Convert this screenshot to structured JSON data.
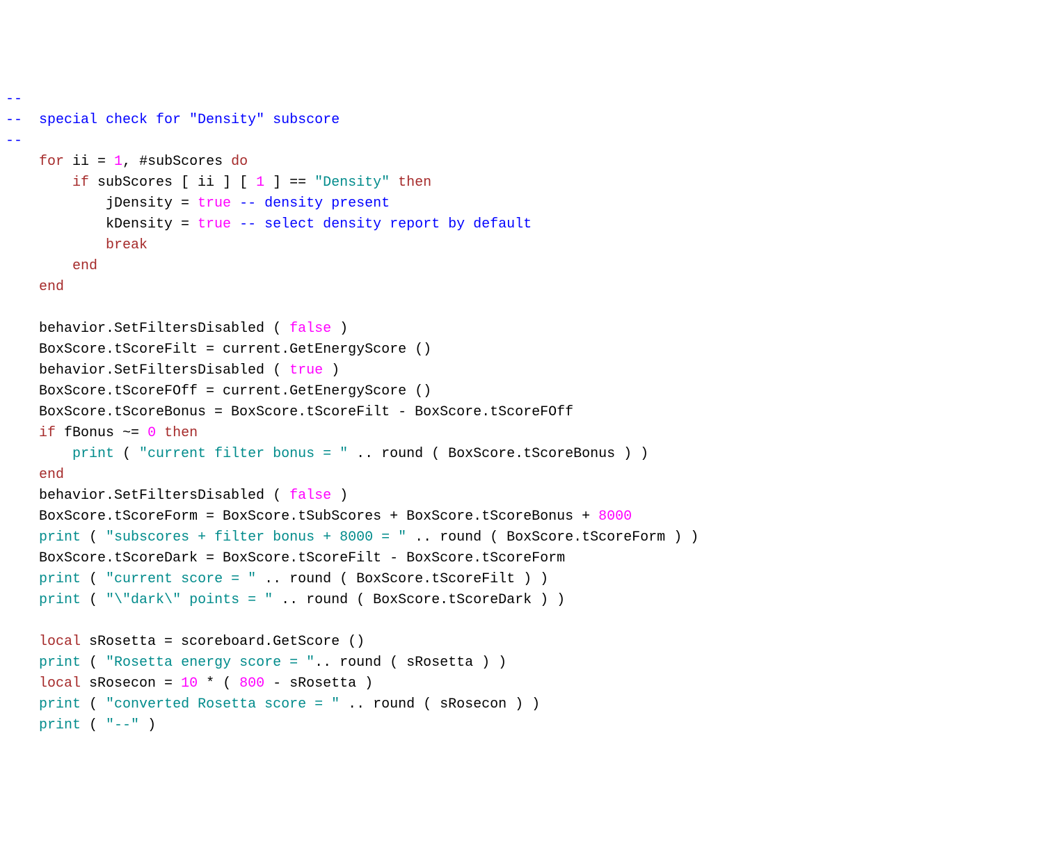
{
  "code": {
    "l01": "--",
    "l02a": "--  ",
    "l02b": "special check for \"Density\" subscore",
    "l03": "--",
    "l04_for": "for",
    "l04_ii": " ii = ",
    "l04_one": "1",
    "l04_rest": ", #subScores ",
    "l04_do": "do",
    "l05_if": "if",
    "l05_cond": " subScores [ ii ] [ ",
    "l05_one": "1",
    "l05_close": " ] == ",
    "l05_str": "\"Density\"",
    "l05_then": " then",
    "l06_a": "            jDensity = ",
    "l06_true": "true",
    "l06_c": " -- density present",
    "l07_a": "            kDensity = ",
    "l07_true": "true",
    "l07_c": " -- select density report by default",
    "l08_break": "break",
    "l09_end": "end",
    "l10_end": "end",
    "l12": "    behavior.SetFiltersDisabled ( ",
    "l12_false": "false",
    "l12_b": " )",
    "l13": "    BoxScore.tScoreFilt = current.GetEnergyScore ()",
    "l14": "    behavior.SetFiltersDisabled ( ",
    "l14_true": "true",
    "l14_b": " )",
    "l15": "    BoxScore.tScoreFOff = current.GetEnergyScore ()",
    "l16": "    BoxScore.tScoreBonus = BoxScore.tScoreFilt - BoxScore.tScoreFOff",
    "l17_if": "if",
    "l17_a": " fBonus ~= ",
    "l17_zero": "0",
    "l17_then": " then",
    "l18_print": "print",
    "l18_a": " ( ",
    "l18_str": "\"current filter bonus = \"",
    "l18_b": " .. round ( BoxScore.tScoreBonus ) )",
    "l19_end": "end",
    "l20": "    behavior.SetFiltersDisabled ( ",
    "l20_false": "false",
    "l20_b": " )",
    "l21_a": "    BoxScore.tScoreForm = BoxScore.tSubScores + BoxScore.tScoreBonus + ",
    "l21_num": "8000",
    "l22_print": "print",
    "l22_a": " ( ",
    "l22_str": "\"subscores + filter bonus + 8000 = \"",
    "l22_b": " .. round ( BoxScore.tScoreForm ) )",
    "l23": "    BoxScore.tScoreDark = BoxScore.tScoreFilt - BoxScore.tScoreForm",
    "l24_print": "print",
    "l24_a": " ( ",
    "l24_str": "\"current score = \"",
    "l24_b": " .. round ( BoxScore.tScoreFilt ) )",
    "l25_print": "print",
    "l25_a": " ( ",
    "l25_str": "\"\\\"dark\\\" points = \"",
    "l25_b": " .. round ( BoxScore.tScoreDark ) )",
    "l27_local": "local",
    "l27_a": " sRosetta = scoreboard.GetScore ()",
    "l28_print": "print",
    "l28_a": " ( ",
    "l28_str": "\"Rosetta energy score = \"",
    "l28_b": ".. round ( sRosetta ) )",
    "l29_local": "local",
    "l29_a": " sRosecon = ",
    "l29_ten": "10",
    "l29_b": " * ( ",
    "l29_800": "800",
    "l29_c": " - sRosetta )",
    "l30_print": "print",
    "l30_a": " ( ",
    "l30_str": "\"converted Rosetta score = \"",
    "l30_b": " .. round ( sRosecon ) )",
    "l31_print": "print",
    "l31_a": " ( ",
    "l31_str": "\"--\"",
    "l31_b": " )"
  }
}
